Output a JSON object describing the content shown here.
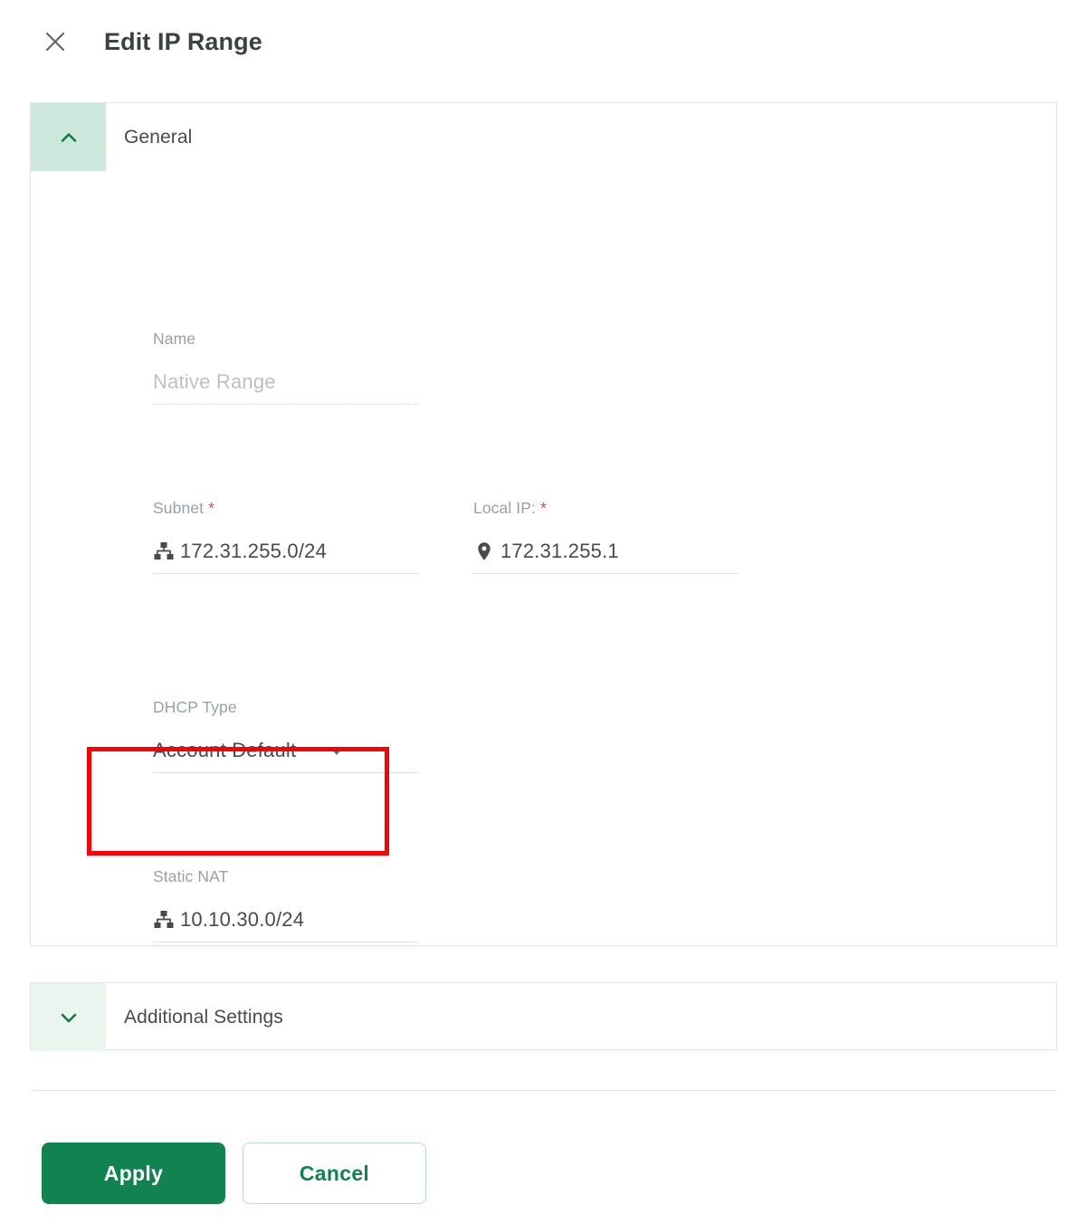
{
  "header": {
    "close_icon": "close-icon",
    "title": "Edit IP Range"
  },
  "sections": {
    "general": {
      "title": "General",
      "expanded": true,
      "toggle_icon": "chevron-up-icon",
      "fields": {
        "name": {
          "label": "Name",
          "value": "Native Range",
          "disabled": true,
          "required": false,
          "icon": ""
        },
        "subnet": {
          "label": "Subnet",
          "required": true,
          "required_marker": "*",
          "value": "172.31.255.0/24",
          "icon": "network-icon"
        },
        "local_ip": {
          "label": "Local IP:",
          "required": true,
          "required_marker": "*",
          "value": "172.31.255.1",
          "icon": "location-pin-icon"
        },
        "dhcp_type": {
          "label": "DHCP Type",
          "value": "Account Default",
          "icon": "chevron-down-filled-icon",
          "required": false
        },
        "static_nat": {
          "label": "Static NAT",
          "value": "10.10.30.0/24",
          "icon": "network-icon",
          "required": false,
          "highlighted": true
        }
      }
    },
    "additional": {
      "title": "Additional Settings",
      "expanded": false,
      "toggle_icon": "chevron-down-icon"
    }
  },
  "footer": {
    "apply_label": "Apply",
    "cancel_label": "Cancel"
  },
  "colors": {
    "primary_green": "#118350",
    "accent_mint_expanded": "#cce8dc",
    "accent_mint_collapsed": "#eaf5ef",
    "required_red": "#e8453c",
    "annotation_red": "#ff0000",
    "label_gray": "#9aa0a6",
    "value_gray": "#4a4a4a"
  }
}
